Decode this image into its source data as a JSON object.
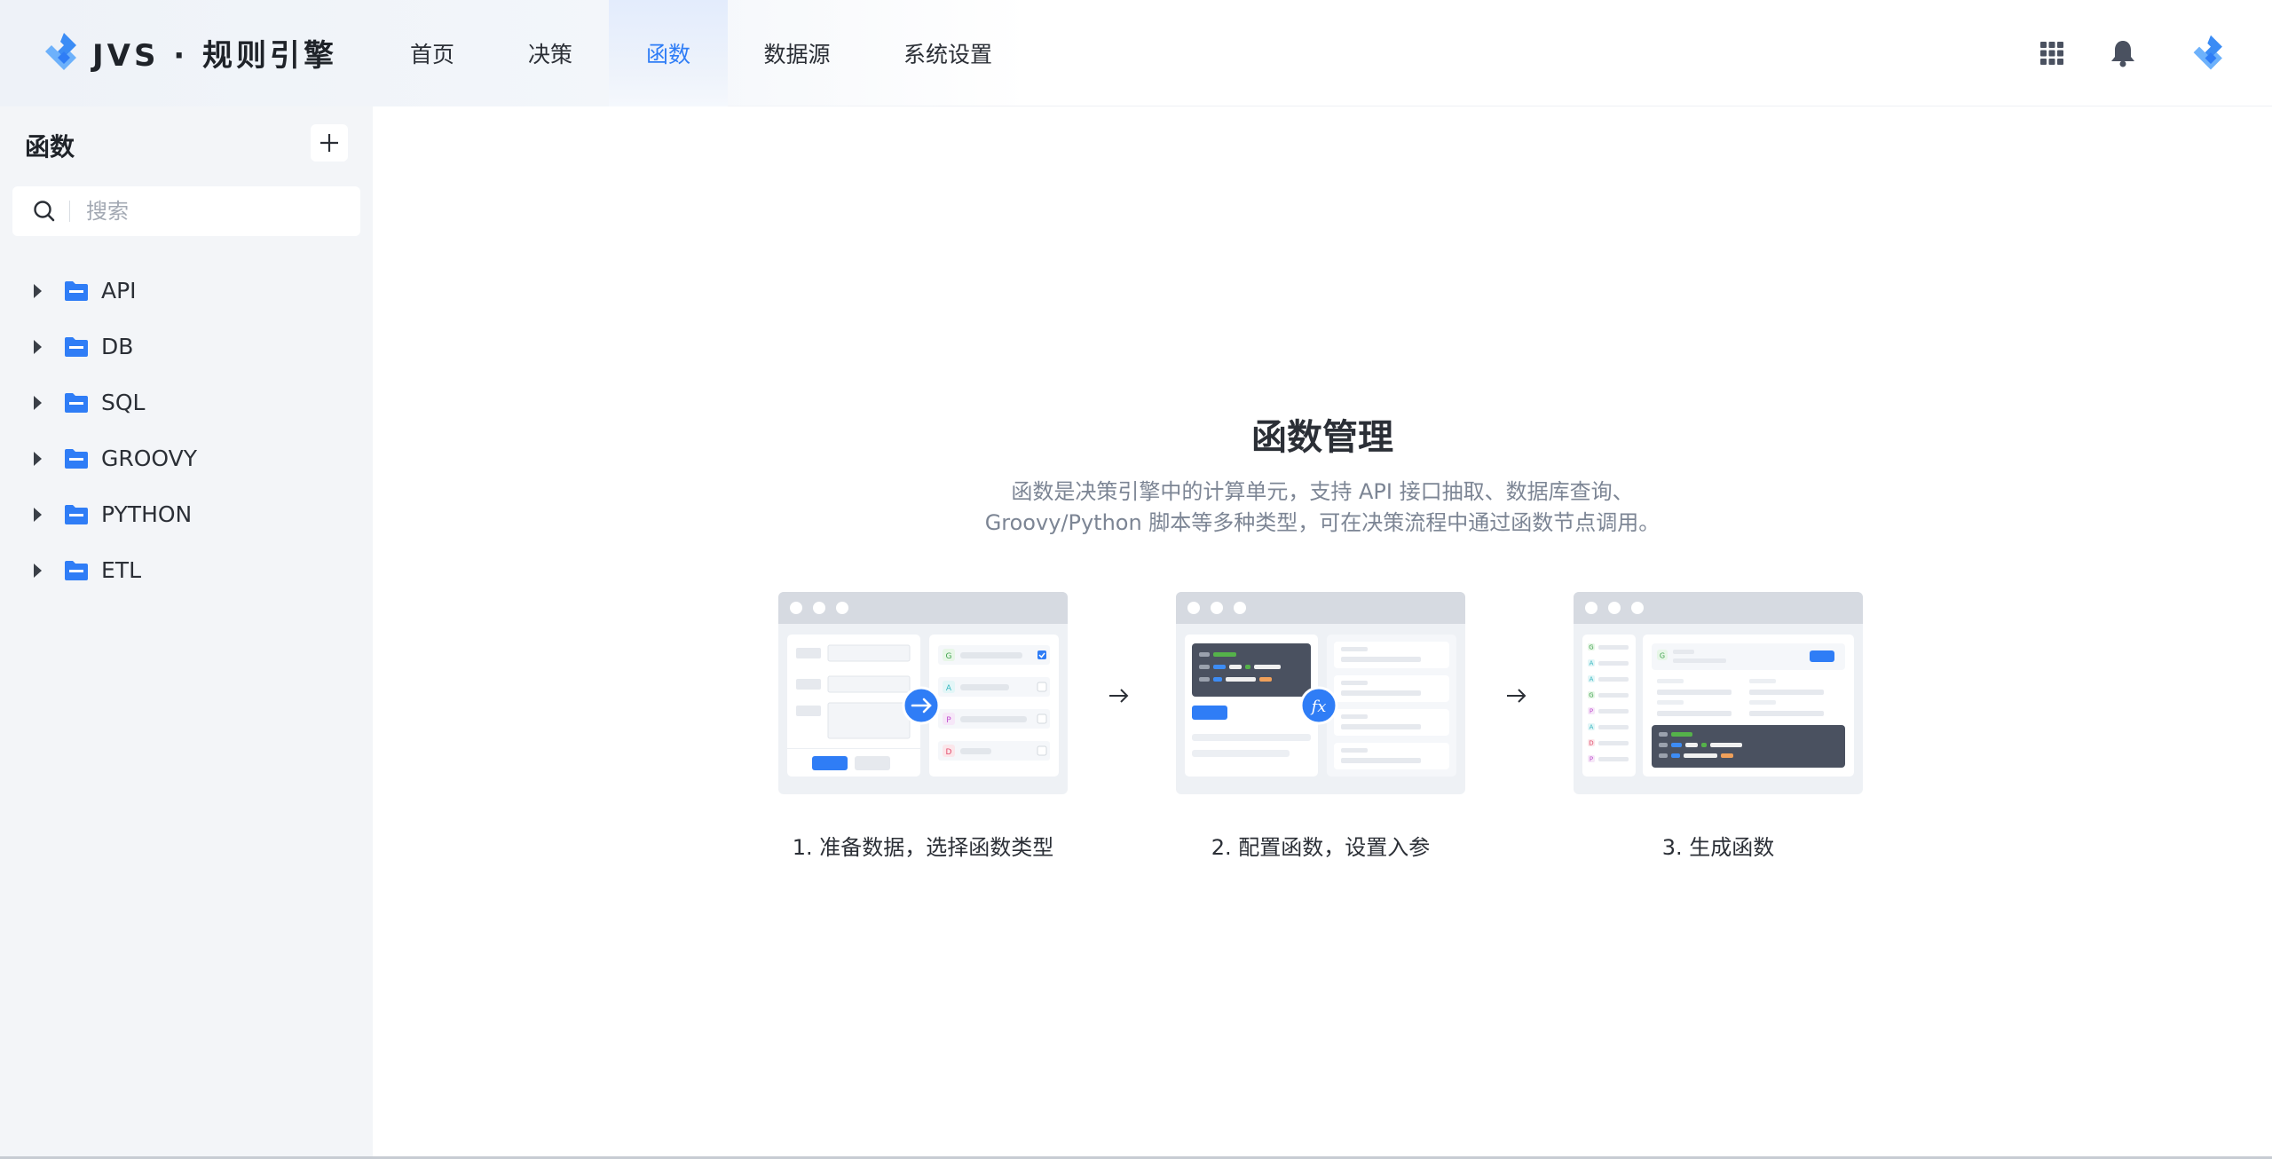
{
  "header": {
    "logo_text": "JVS · 规则引擎",
    "nav": [
      {
        "label": "首页",
        "active": false
      },
      {
        "label": "决策",
        "active": false
      },
      {
        "label": "函数",
        "active": true
      },
      {
        "label": "数据源",
        "active": false
      },
      {
        "label": "系统设置",
        "active": false
      }
    ],
    "icons": [
      "apps-grid-icon",
      "bell-icon",
      "app-logo-icon"
    ]
  },
  "sidebar": {
    "title": "函数",
    "add_icon": "plus-icon",
    "search": {
      "placeholder": "搜索",
      "value": ""
    },
    "items": [
      {
        "label": "API"
      },
      {
        "label": "DB"
      },
      {
        "label": "SQL"
      },
      {
        "label": "GROOVY"
      },
      {
        "label": "PYTHON"
      },
      {
        "label": "ETL"
      }
    ]
  },
  "main": {
    "title": "函数管理",
    "description_line1": "函数是决策引擎中的计算单元，支持 API 接口抽取、数据库查询、",
    "description_line2": "Groovy/Python 脚本等多种类型，可在决策流程中通过函数节点调用。",
    "steps": [
      {
        "label": "1. 准备数据，选择函数类型"
      },
      {
        "label": "2. 配置函数，设置入参"
      },
      {
        "label": "3. 生成函数"
      }
    ],
    "step_badges": {
      "left_tags": [
        "G",
        "A",
        "P",
        "D"
      ],
      "fx_symbol": "fx",
      "right_tag": "G",
      "right_list_tags": [
        "G",
        "A",
        "A",
        "G",
        "P",
        "A",
        "D",
        "P"
      ]
    }
  },
  "colors": {
    "accent": "#2f7df6",
    "sidebar_bg": "#f3f5f8",
    "folder": "#2f7df6",
    "dark_panel": "#4a5160"
  }
}
